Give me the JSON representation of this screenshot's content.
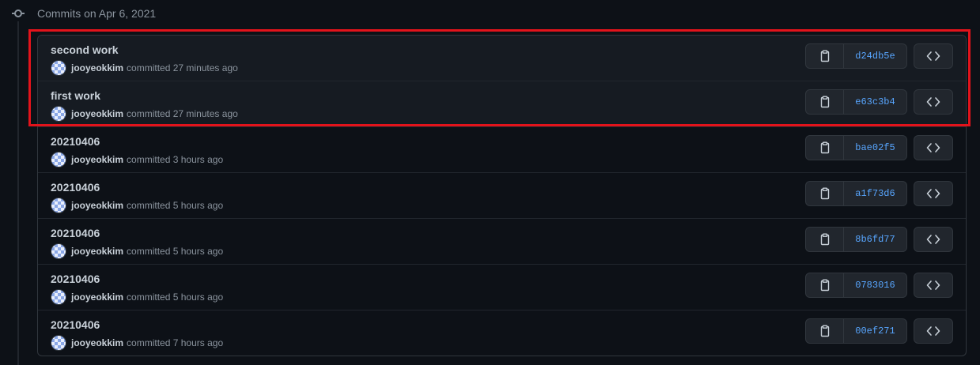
{
  "timeline": {
    "heading": "Commits on Apr 6, 2021"
  },
  "commits": [
    {
      "title": "second work",
      "author": "jooyeokkim",
      "action": "committed",
      "time": "27 minutes ago",
      "sha": "d24db5e"
    },
    {
      "title": "first work",
      "author": "jooyeokkim",
      "action": "committed",
      "time": "27 minutes ago",
      "sha": "e63c3b4"
    },
    {
      "title": "20210406",
      "author": "jooyeokkim",
      "action": "committed",
      "time": "3 hours ago",
      "sha": "bae02f5"
    },
    {
      "title": "20210406",
      "author": "jooyeokkim",
      "action": "committed",
      "time": "5 hours ago",
      "sha": "a1f73d6"
    },
    {
      "title": "20210406",
      "author": "jooyeokkim",
      "action": "committed",
      "time": "5 hours ago",
      "sha": "8b6fd77"
    },
    {
      "title": "20210406",
      "author": "jooyeokkim",
      "action": "committed",
      "time": "5 hours ago",
      "sha": "0783016"
    },
    {
      "title": "20210406",
      "author": "jooyeokkim",
      "action": "committed",
      "time": "7 hours ago",
      "sha": "00ef271"
    }
  ],
  "icons": {
    "commit": "git-commit-icon",
    "copy": "clipboard-icon",
    "browse": "code-icon"
  },
  "colors": {
    "background": "#0d1117",
    "sha_link": "#58a6ff",
    "highlight": "#e3131b"
  }
}
